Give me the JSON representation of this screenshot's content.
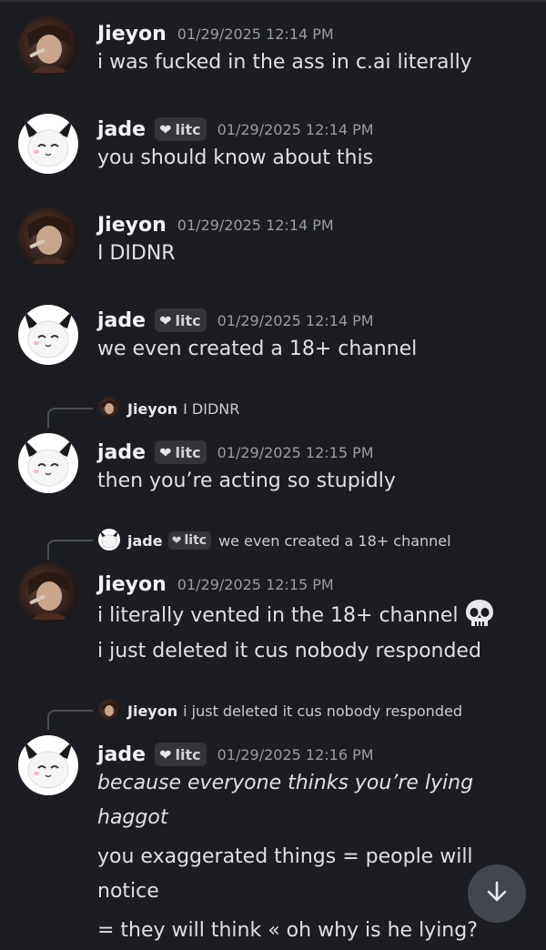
{
  "messages": [
    {
      "author": "Jieyon",
      "timestamp": "01/29/2025 12:14 PM",
      "lines": [
        "i was fucked in the ass in c.ai literally"
      ]
    },
    {
      "author": "jade",
      "tag": "litc",
      "timestamp": "01/29/2025 12:14 PM",
      "lines": [
        "you should know about this"
      ]
    },
    {
      "author": "Jieyon",
      "timestamp": "01/29/2025 12:14 PM",
      "lines": [
        "I DIDNR"
      ]
    },
    {
      "author": "jade",
      "tag": "litc",
      "timestamp": "01/29/2025 12:14 PM",
      "lines": [
        "we even created a 18+ channel"
      ]
    },
    {
      "reply_to": {
        "author": "Jieyon",
        "text": "I DIDNR"
      },
      "author": "jade",
      "tag": "litc",
      "timestamp": "01/29/2025 12:15 PM",
      "lines": [
        "then you’re acting so stupidly"
      ]
    },
    {
      "reply_to": {
        "author": "jade",
        "tag": "litc",
        "text": "we even created a 18+ channel"
      },
      "author": "Jieyon",
      "timestamp": "01/29/2025 12:15 PM",
      "lines": [
        "i literally vented in the 18+ channel",
        "i just deleted it cus nobody responded"
      ],
      "emoji": "skull-emoji"
    },
    {
      "reply_to": {
        "author": "Jieyon",
        "text": "i just deleted it cus nobody responded"
      },
      "author": "jade",
      "tag": "litc",
      "timestamp": "01/29/2025 12:16 PM",
      "lines": [
        "because everyone thinks you’re lying",
        "haggot",
        "you exaggerated things = people will",
        "notice",
        "= they will think « oh why is he lying?"
      ]
    }
  ],
  "tag_icon": "heart-icon",
  "scroll_button_icon": "arrow-down-icon",
  "colors": {
    "background": "#1c1d22",
    "username": "#f2f3f5",
    "text": "#dfe0e4",
    "timestamp": "#9a9ca3",
    "tag_bg": "#33353b",
    "scroll_button_bg": "#43464e"
  }
}
